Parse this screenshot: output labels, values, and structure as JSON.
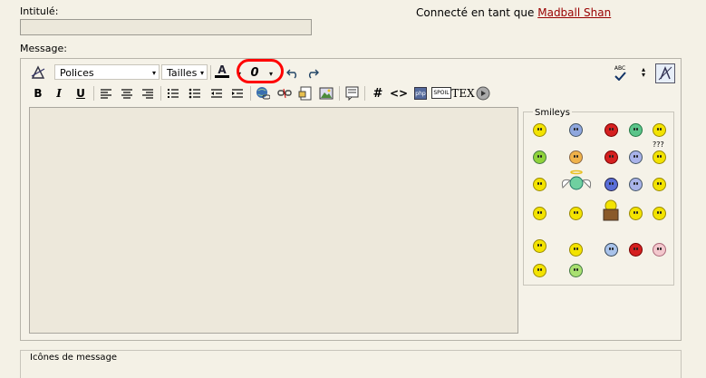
{
  "form": {
    "title_label": "Intitulé:",
    "message_label": "Message:",
    "icons_label": "Icônes de message"
  },
  "user": {
    "connected_prefix": "Connecté en tant que",
    "username": "Madball Shan"
  },
  "toolbar": {
    "font_select": "Polices",
    "size_select": "Tailles",
    "size_arrow": "▾",
    "font_arrow": "▾",
    "bold": "B",
    "italic": "I",
    "underline": "U",
    "hash": "#",
    "code": "<>",
    "spoil": "SPOIL",
    "tex": "TEX",
    "php": "php",
    "abc": "ABC",
    "tooltip_icon": "0",
    "font_color_letter": "A"
  },
  "smileys": {
    "title": "Smileys",
    "question_marks": "???"
  },
  "colors": {
    "background": "#f4f1e6",
    "link": "#990000",
    "highlight": "#ff0000"
  }
}
